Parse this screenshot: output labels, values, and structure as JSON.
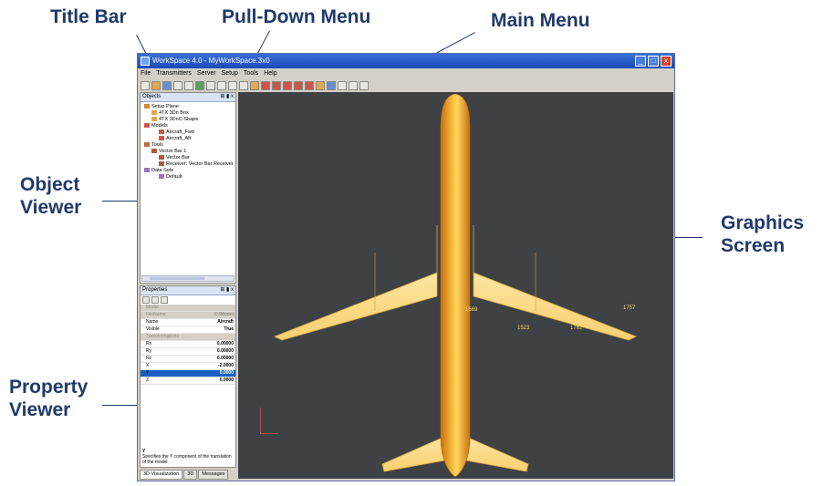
{
  "callouts": {
    "title_bar": "Title Bar",
    "pulldown_menu": "Pull-Down Menu",
    "main_menu": "Main Menu",
    "object_viewer": [
      "Object",
      "Viewer"
    ],
    "graphics_screen": [
      "Graphics",
      "Screen"
    ],
    "property_viewer": [
      "Property",
      "Viewer"
    ]
  },
  "window": {
    "title": "WorkSpace 4.0 - MyWorkSpace.3x0",
    "buttons": [
      "_",
      "□",
      "x"
    ]
  },
  "menu": [
    "File",
    "Transmitters",
    "Server",
    "Setup",
    "Tools",
    "Help"
  ],
  "objects_panel": {
    "title": "Objects",
    "pin": "⊞ ▮ x",
    "tree": [
      {
        "label": "Setup Plane",
        "indent": 0,
        "color": "#d08a30"
      },
      {
        "label": "4TX 3Dn Box",
        "indent": 1,
        "color": "#e0a850"
      },
      {
        "label": "4TX 3DnC-Shape",
        "indent": 1,
        "color": "#e0a850"
      },
      {
        "label": "Models",
        "indent": 0,
        "color": "#c8584a"
      },
      {
        "label": "Aircraft_Fwd",
        "indent": 2,
        "color": "#c85a4a"
      },
      {
        "label": "Aircraft_Aft",
        "indent": 2,
        "color": "#c85a4a"
      },
      {
        "label": "Tools",
        "indent": 0,
        "color": "#c06a40"
      },
      {
        "label": "Vector Bar 1",
        "indent": 1,
        "color": "#b05a3a"
      },
      {
        "label": "Vector Bar",
        "indent": 2,
        "color": "#b05a3a"
      },
      {
        "label": "Receiver: Vector Bar Receiver",
        "indent": 2,
        "color": "#b05a3a"
      },
      {
        "label": "Data Sets",
        "indent": 0,
        "color": "#a070c0"
      },
      {
        "label": "Default",
        "indent": 2,
        "color": "#a070c0"
      }
    ]
  },
  "properties_panel": {
    "title": "Properties",
    "pin": "⊞ ▮ x",
    "rows": [
      {
        "k": "Model",
        "v": "",
        "cat": true
      },
      {
        "k": "FileName",
        "v": "C:\\Model",
        "cat": true
      },
      {
        "k": "Name",
        "v": "Aircraft"
      },
      {
        "k": "Visible",
        "v": "True"
      },
      {
        "k": "Transformations",
        "v": "",
        "cat": true
      },
      {
        "k": "Rx",
        "v": "0.00000"
      },
      {
        "k": "Ry",
        "v": "0.00000"
      },
      {
        "k": "Rz",
        "v": "0.00000"
      },
      {
        "k": "X",
        "v": "-2.0000"
      },
      {
        "k": "Y",
        "v": "0.0000",
        "sel": true
      },
      {
        "k": "Z",
        "v": "0.0000"
      }
    ],
    "description_title": "Y",
    "description": "Specifies the Y component of the translation of the model"
  },
  "tabs": [
    "3D Visualization",
    "3D",
    "Messages"
  ],
  "graphics": {
    "points": [
      {
        "label": "1669"
      },
      {
        "label": "1757"
      },
      {
        "label": "1523"
      },
      {
        "label": "1762"
      }
    ],
    "background": "#3e4245",
    "aircraft_color": "#f0a020"
  }
}
